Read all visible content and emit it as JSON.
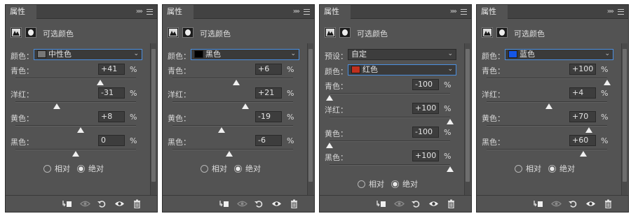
{
  "panels": [
    {
      "tab_label": "属性",
      "adjustment_title": "可选颜色",
      "preset_label": "",
      "preset_value": "",
      "colors_label": "颜色：",
      "colors_value": "中性色",
      "colors_swatch": "#777777",
      "sliders": [
        {
          "label": "青色：",
          "value": "+41",
          "pct": "%",
          "level": 41
        },
        {
          "label": "洋红：",
          "value": "-31",
          "pct": "%",
          "level": -31
        },
        {
          "label": "黄色：",
          "value": "+8",
          "pct": "%",
          "level": 8
        },
        {
          "label": "黑色：",
          "value": "0",
          "pct": "%",
          "level": 0
        }
      ],
      "method_relative": "相对",
      "method_absolute": "绝对",
      "method_selected": "absolute"
    },
    {
      "tab_label": "属性",
      "adjustment_title": "可选颜色",
      "preset_label": "",
      "preset_value": "",
      "colors_label": "颜色：",
      "colors_value": "黑色",
      "colors_swatch": "#000000",
      "sliders": [
        {
          "label": "青色：",
          "value": "+6",
          "pct": "%",
          "level": 6
        },
        {
          "label": "洋红：",
          "value": "+21",
          "pct": "%",
          "level": 21
        },
        {
          "label": "黄色：",
          "value": "-19",
          "pct": "%",
          "level": -19
        },
        {
          "label": "黑色：",
          "value": "-6",
          "pct": "%",
          "level": -6
        }
      ],
      "method_relative": "相对",
      "method_absolute": "绝对",
      "method_selected": "absolute"
    },
    {
      "tab_label": "属性",
      "adjustment_title": "可选颜色",
      "preset_label": "预设：",
      "preset_value": "自定",
      "colors_label": "颜色：",
      "colors_value": "红色",
      "colors_swatch": "#c0301e",
      "sliders": [
        {
          "label": "青色：",
          "value": "-100",
          "pct": "%",
          "level": -100
        },
        {
          "label": "洋红：",
          "value": "+100",
          "pct": "%",
          "level": 100
        },
        {
          "label": "黄色：",
          "value": "-100",
          "pct": "%",
          "level": -100
        },
        {
          "label": "黑色：",
          "value": "+100",
          "pct": "%",
          "level": 100
        }
      ],
      "method_relative": "相对",
      "method_absolute": "绝对",
      "method_selected": "absolute"
    },
    {
      "tab_label": "属性",
      "adjustment_title": "可选颜色",
      "preset_label": "",
      "preset_value": "",
      "colors_label": "颜色：",
      "colors_value": "蓝色",
      "colors_swatch": "#1556e6",
      "sliders": [
        {
          "label": "青色：",
          "value": "+100",
          "pct": "%",
          "level": 100
        },
        {
          "label": "洋红：",
          "value": "+4",
          "pct": "%",
          "level": 4
        },
        {
          "label": "黄色：",
          "value": "+70",
          "pct": "%",
          "level": 70
        },
        {
          "label": "黑色：",
          "value": "+60",
          "pct": "%",
          "level": 60
        }
      ],
      "method_relative": "相对",
      "method_absolute": "绝对",
      "method_selected": "absolute"
    }
  ],
  "icons": {
    "mask": "mask-thumbnail-icon",
    "adjustment": "adjustment-layer-icon",
    "clip": "clip-to-layer-icon",
    "view_previous": "view-previous-state-icon",
    "reset": "reset-icon",
    "visibility": "eye-icon",
    "delete": "trash-icon"
  }
}
